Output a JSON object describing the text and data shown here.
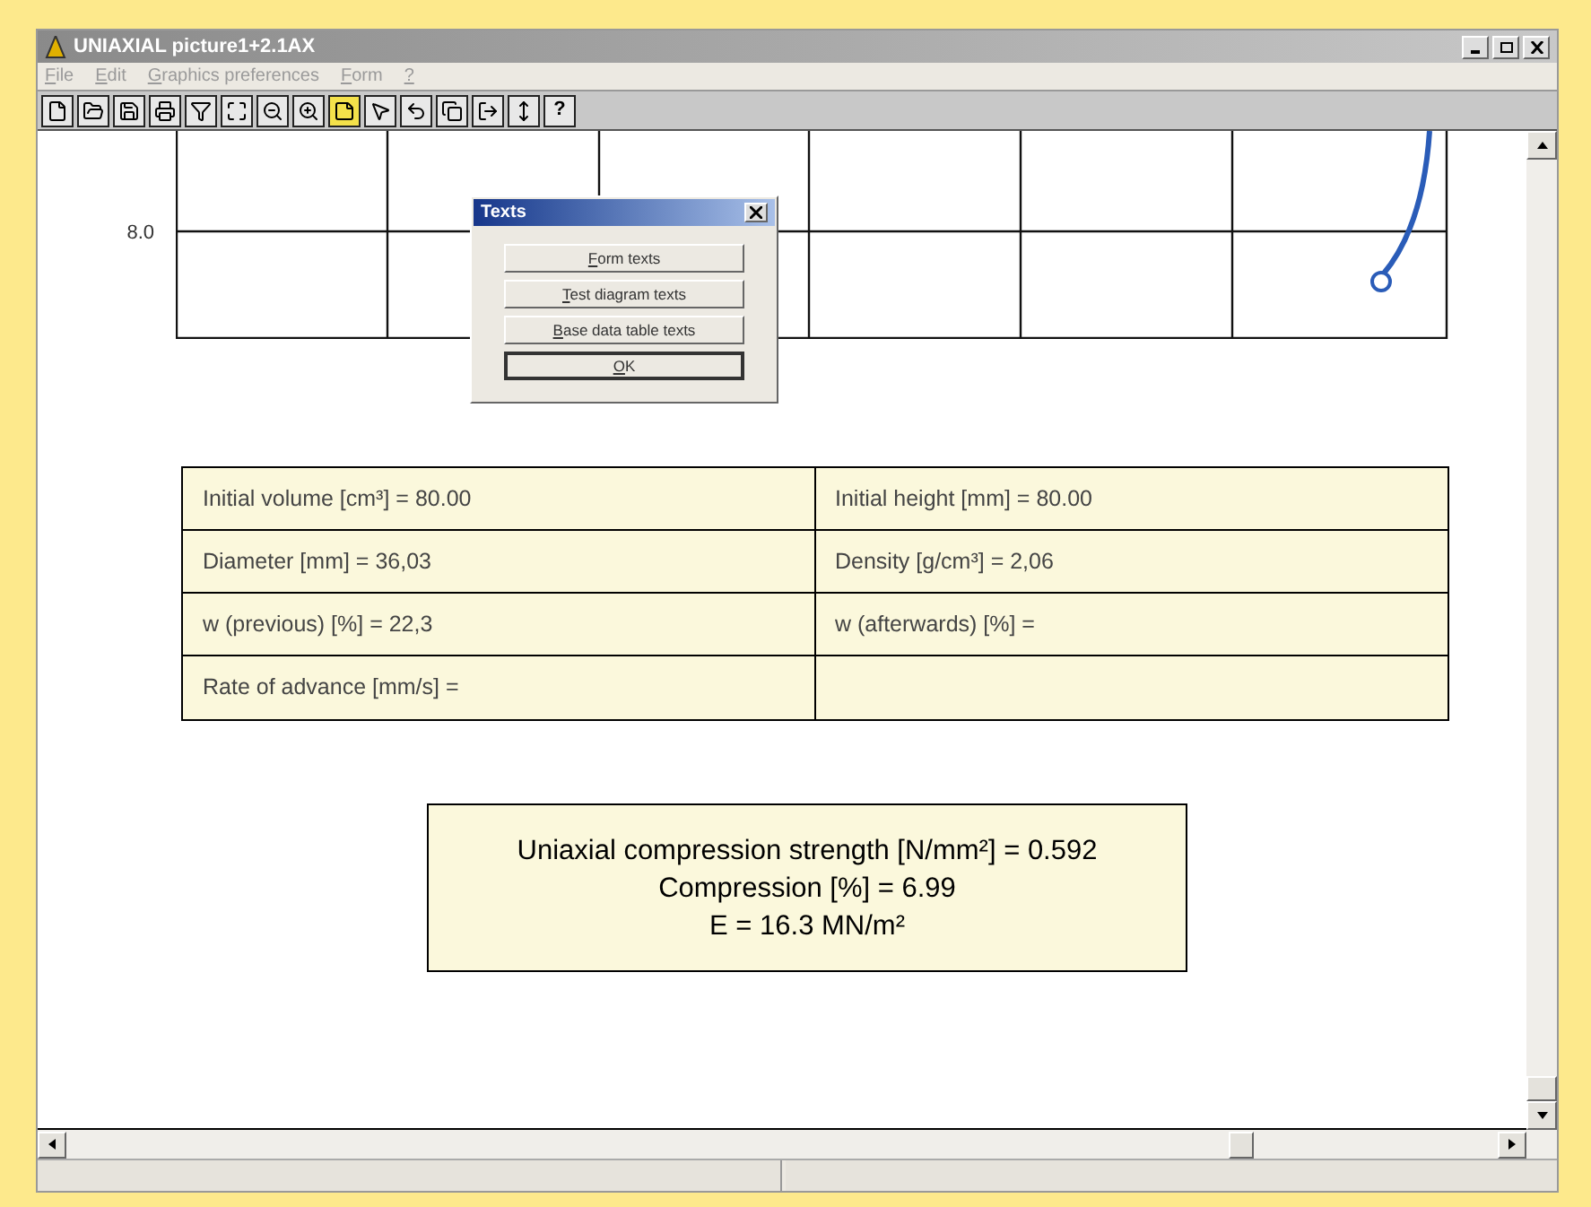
{
  "window": {
    "title": "UNIAXIAL  picture1+2.1AX"
  },
  "menu": [
    {
      "label": "File",
      "disabled": true
    },
    {
      "label": "Edit",
      "disabled": true
    },
    {
      "label": "Graphics preferences",
      "disabled": true
    },
    {
      "label": "Form",
      "disabled": true
    },
    {
      "label": "?",
      "disabled": true
    }
  ],
  "toolbar": [
    {
      "kind": "new"
    },
    {
      "kind": "open"
    },
    {
      "kind": "save"
    },
    {
      "kind": "print"
    },
    {
      "kind": "filter"
    },
    {
      "kind": "zoom-fit"
    },
    {
      "kind": "zoom-out"
    },
    {
      "kind": "zoom-in"
    },
    {
      "kind": "note"
    },
    {
      "kind": "pointer"
    },
    {
      "kind": "undo"
    },
    {
      "kind": "copy"
    },
    {
      "kind": "export"
    },
    {
      "kind": "height"
    },
    {
      "kind": "help",
      "label": "?"
    }
  ],
  "diagram": {
    "y_label": "8.0"
  },
  "dialog": {
    "title": "Texts",
    "buttons": [
      {
        "label": "Form texts",
        "default": false
      },
      {
        "label": "Test diagram texts",
        "default": false
      },
      {
        "label": "Base data table texts",
        "default": false
      },
      {
        "label": "OK",
        "default": true
      }
    ]
  },
  "table": {
    "rows": [
      [
        "Initial volume [cm³] =  80.00",
        "Initial height [mm] =  80.00"
      ],
      [
        "Diameter [mm] =  36,03",
        "Density [g/cm³] =  2,06"
      ],
      [
        "w (previous) [%] =  22,3",
        "w (afterwards) [%] ="
      ],
      [
        "Rate of advance [mm/s] ="
      ]
    ]
  },
  "results": [
    "Uniaxial compression strength [N/mm²] = 0.592",
    "Compression [%] = 6.99",
    "E  = 16.3 MN/m²"
  ]
}
